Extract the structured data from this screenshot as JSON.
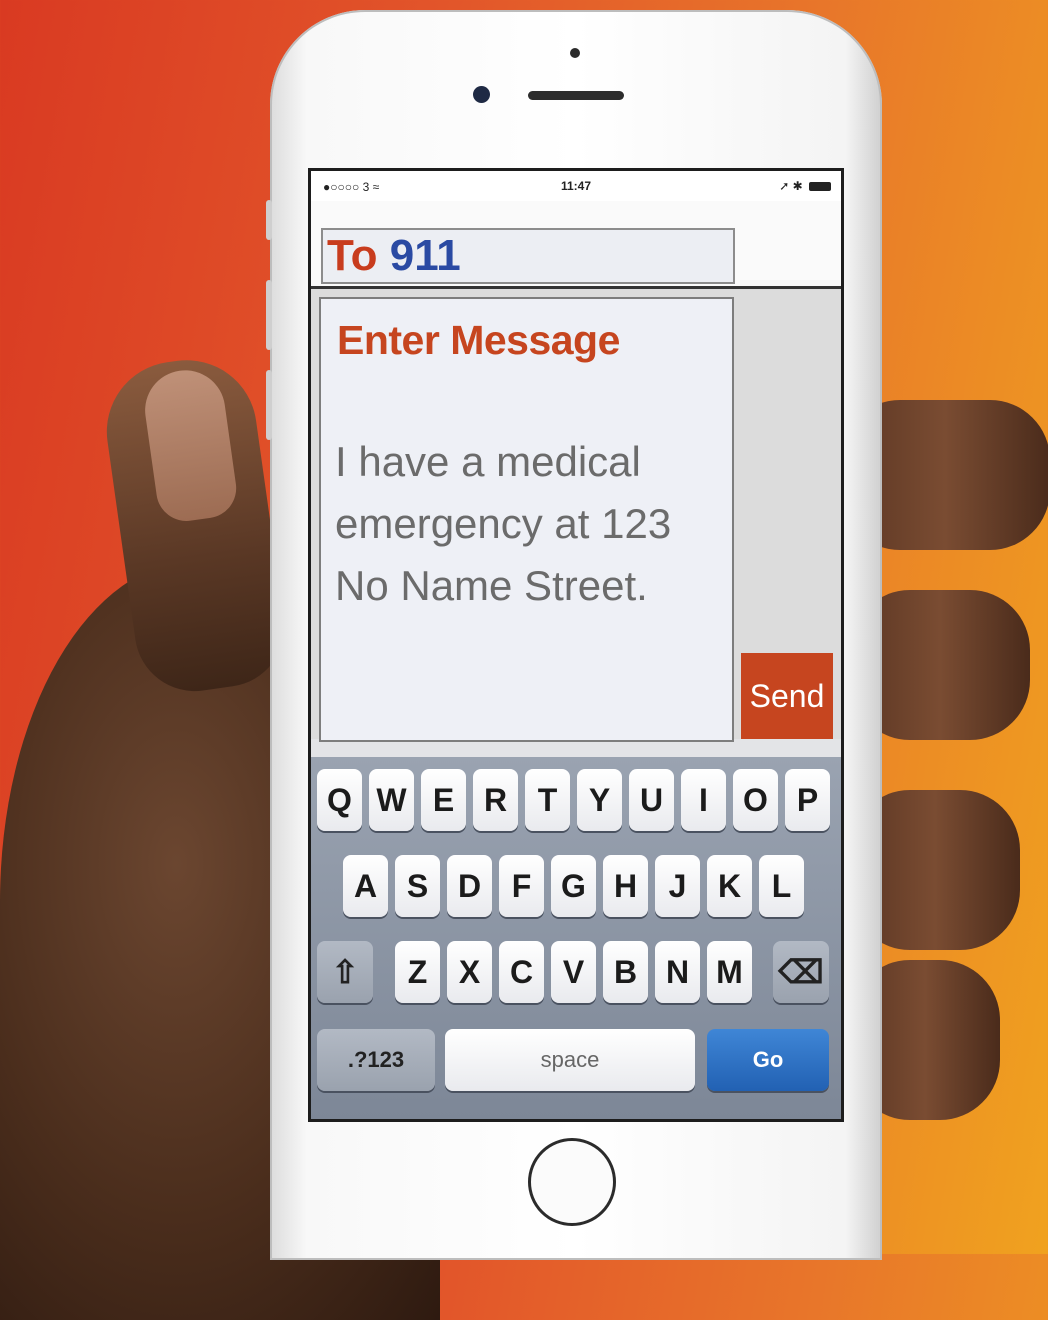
{
  "status_bar": {
    "carrier": "●○○○○ 3 ≈",
    "time": "11:47",
    "right_icons": "➚ ✱"
  },
  "recipient": {
    "label": "To",
    "number": "911"
  },
  "message": {
    "header": "Enter Message",
    "body": "I have a medical emergency at 123 No Name Street.",
    "send_label": "Send"
  },
  "keyboard": {
    "row1": [
      "Q",
      "W",
      "E",
      "R",
      "T",
      "Y",
      "U",
      "I",
      "O",
      "P"
    ],
    "row2": [
      "A",
      "S",
      "D",
      "F",
      "G",
      "H",
      "J",
      "K",
      "L"
    ],
    "row3": [
      "Z",
      "X",
      "C",
      "V",
      "B",
      "N",
      "M"
    ],
    "shift_icon": "⇧",
    "delete_icon": "⌫",
    "numbers_label": ".?123",
    "space_label": "space",
    "go_label": "Go"
  },
  "colors": {
    "accent_red": "#c6451f",
    "recipient_blue": "#2a4aa3",
    "go_blue": "#2a6bc0"
  }
}
